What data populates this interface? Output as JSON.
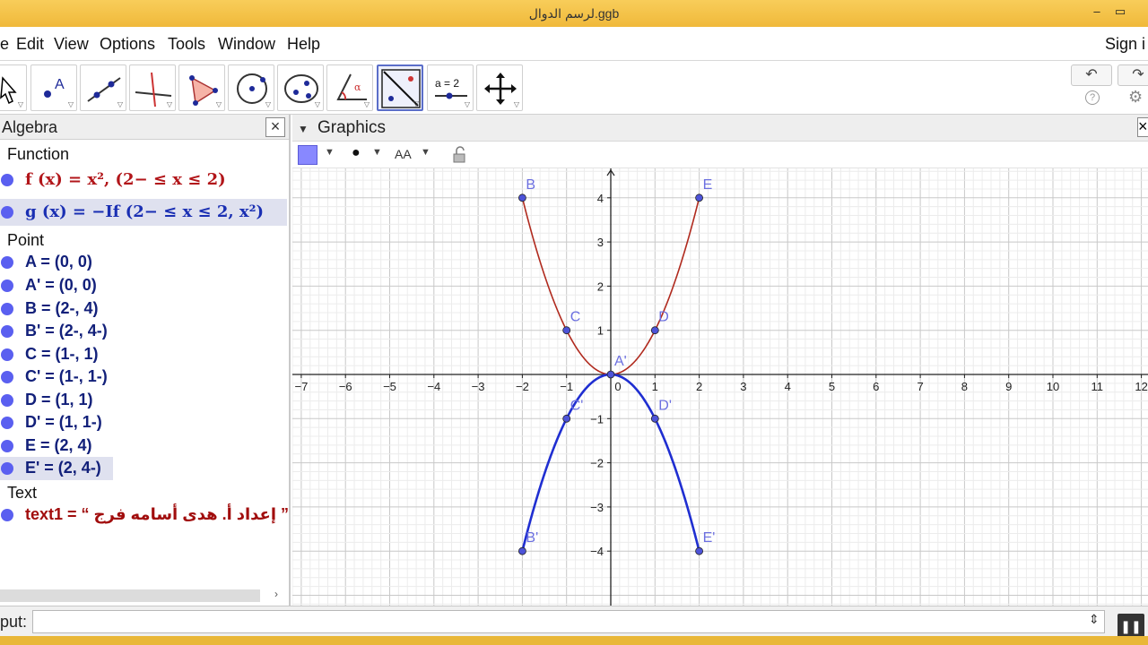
{
  "window": {
    "title": "لرسم الدوال.ggb",
    "minimize": "–",
    "maximize": "▭"
  },
  "menu": {
    "items": [
      "e",
      "Edit",
      "View",
      "Options",
      "Tools",
      "Window",
      "Help"
    ],
    "sign_in": "Sign i"
  },
  "toolbar": {
    "tools": [
      "move-tool",
      "point-tool",
      "line-tool",
      "perpendicular-tool",
      "polygon-tool",
      "circle-tool",
      "conic-tool",
      "angle-tool",
      "reflect-tool",
      "slider-tool",
      "move-view-tool"
    ],
    "active_tool": "reflect-tool",
    "slider_label": "a = 2",
    "undo": "↶",
    "redo": "↷",
    "help": "?",
    "settings": "⚙"
  },
  "algebra": {
    "title": "Algebra",
    "categories": {
      "function": "Function",
      "point": "Point",
      "text": "Text"
    },
    "functions": [
      {
        "text": "f (x)  =  x², (2−  ≤  x  ≤  2)",
        "color": "#b2161a"
      },
      {
        "text": "g (x)  =  −If (2−  ≤  x  ≤  2, x²)",
        "color": "#1a2fb3"
      }
    ],
    "points": [
      "A = (0, 0)",
      "A' = (0, 0)",
      "B = (2-, 4)",
      "B' = (2-, 4-)",
      "C = (1-, 1)",
      "C' = (1-, 1-)",
      "D = (1, 1)",
      "D' = (1, 1-)",
      "E = (2, 4)",
      "E' = (2, 4-)"
    ],
    "texts": [
      "text1 = “ إعداد أ. هدى أسامه فرج ”"
    ],
    "point_color": "#5a5ff0",
    "text_color": "#a10d0d"
  },
  "graphics": {
    "title": "Graphics",
    "style_bar": {
      "color_swatch": "#8888ff",
      "point_style": "●",
      "label_style": "AA"
    }
  },
  "input": {
    "label": "put:",
    "value": "",
    "spin": "⇕",
    "pause": "❚❚"
  },
  "chart_data": {
    "type": "line",
    "xlim": [
      -7,
      12
    ],
    "ylim": [
      -5,
      4.5
    ],
    "x_ticks": [
      -7,
      -6,
      -5,
      -4,
      -3,
      -2,
      -1,
      0,
      1,
      2,
      3,
      4,
      5,
      6,
      7,
      8,
      9,
      10,
      11,
      12
    ],
    "y_ticks": [
      -4,
      -3,
      -2,
      -1,
      1,
      2,
      3,
      4
    ],
    "tick_labels_x": [
      "−7",
      "−6",
      "−5",
      "−4",
      "−3",
      "−2",
      "−1",
      "0",
      "1",
      "2",
      "3",
      "4",
      "5",
      "6",
      "7",
      "8",
      "9",
      "10",
      "11",
      "12"
    ],
    "tick_labels_y": [
      "−4",
      "−3",
      "−2",
      "−1",
      "1",
      "2",
      "3",
      "4"
    ],
    "grid": true,
    "series": [
      {
        "function": "x^2",
        "domain": [
          -2,
          2
        ],
        "color": "#b02a1e"
      },
      {
        "function": "-x^2",
        "domain": [
          -2,
          2
        ],
        "color": "#1f2ed1"
      }
    ],
    "points": [
      {
        "label": "B",
        "x": -2,
        "y": 4
      },
      {
        "label": "E",
        "x": 2,
        "y": 4
      },
      {
        "label": "C",
        "x": -1,
        "y": 1
      },
      {
        "label": "D",
        "x": 1,
        "y": 1
      },
      {
        "label": "A'",
        "x": 0,
        "y": 0
      },
      {
        "label": "C'",
        "x": -1,
        "y": -1
      },
      {
        "label": "D'",
        "x": 1,
        "y": -1
      },
      {
        "label": "B'",
        "x": -2,
        "y": -4
      },
      {
        "label": "E'",
        "x": 2,
        "y": -4
      }
    ],
    "point_color": "#4d53d8",
    "label_color": "#6b6fe0"
  }
}
